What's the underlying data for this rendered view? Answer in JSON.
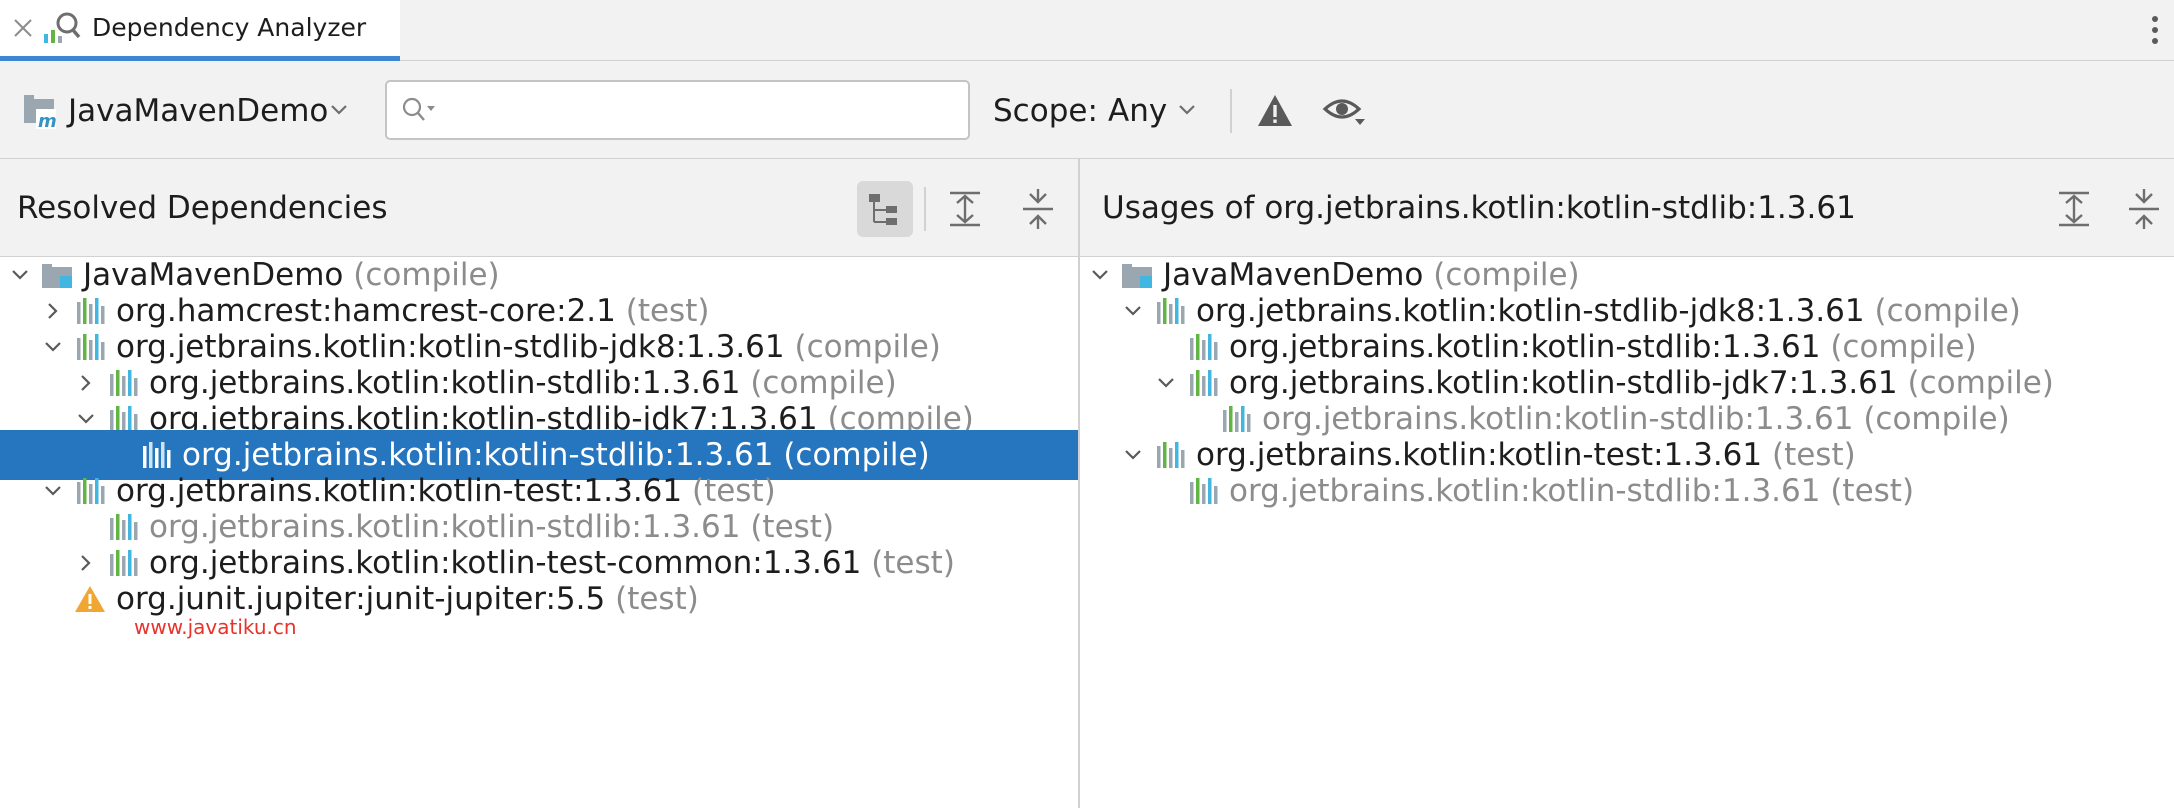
{
  "tab": {
    "title": "Dependency Analyzer"
  },
  "toolbar": {
    "project_name": "JavaMavenDemo",
    "search_value": "",
    "search_placeholder": "",
    "scope_label": "Scope:",
    "scope_value": "Any"
  },
  "left_panel": {
    "title": "Resolved Dependencies",
    "rows": [
      {
        "name": "JavaMavenDemo",
        "scope": "(compile)",
        "icon": "maven-module-icon",
        "depth": 0,
        "expander": "expanded",
        "selected": false,
        "dimmed": false
      },
      {
        "name": "org.hamcrest:hamcrest-core:2.1",
        "scope": "(test)",
        "icon": "library-icon",
        "depth": 1,
        "expander": "collapsed",
        "selected": false,
        "dimmed": false
      },
      {
        "name": "org.jetbrains.kotlin:kotlin-stdlib-jdk8:1.3.61",
        "scope": "(compile)",
        "icon": "library-icon",
        "depth": 1,
        "expander": "expanded",
        "selected": false,
        "dimmed": false
      },
      {
        "name": "org.jetbrains.kotlin:kotlin-stdlib:1.3.61",
        "scope": "(compile)",
        "icon": "library-icon",
        "depth": 2,
        "expander": "collapsed",
        "selected": false,
        "dimmed": false
      },
      {
        "name": "org.jetbrains.kotlin:kotlin-stdlib-jdk7:1.3.61",
        "scope": "(compile)",
        "icon": "library-icon",
        "depth": 2,
        "expander": "expanded",
        "selected": false,
        "dimmed": false
      },
      {
        "name": "org.jetbrains.kotlin:kotlin-stdlib:1.3.61",
        "scope": "(compile)",
        "icon": "library-icon",
        "depth": 3,
        "expander": "none",
        "selected": true,
        "dimmed": false
      },
      {
        "name": "org.jetbrains.kotlin:kotlin-test:1.3.61",
        "scope": "(test)",
        "icon": "library-icon",
        "depth": 1,
        "expander": "expanded",
        "selected": false,
        "dimmed": false
      },
      {
        "name": "org.jetbrains.kotlin:kotlin-stdlib:1.3.61",
        "scope": "(test)",
        "icon": "library-icon",
        "depth": 2,
        "expander": "none",
        "selected": false,
        "dimmed": true
      },
      {
        "name": "org.jetbrains.kotlin:kotlin-test-common:1.3.61",
        "scope": "(test)",
        "icon": "library-icon",
        "depth": 2,
        "expander": "collapsed",
        "selected": false,
        "dimmed": false
      },
      {
        "name": "org.junit.jupiter:junit-jupiter:5.5",
        "scope": "(test)",
        "icon": "warning-icon",
        "depth": 1,
        "expander": "none",
        "selected": false,
        "dimmed": false
      }
    ]
  },
  "right_panel": {
    "title": "Usages of org.jetbrains.kotlin:kotlin-stdlib:1.3.61",
    "rows": [
      {
        "name": "JavaMavenDemo",
        "scope": "(compile)",
        "icon": "maven-module-icon",
        "depth": 0,
        "expander": "expanded",
        "selected": false,
        "dimmed": false
      },
      {
        "name": "org.jetbrains.kotlin:kotlin-stdlib-jdk8:1.3.61",
        "scope": "(compile)",
        "icon": "library-icon",
        "depth": 1,
        "expander": "expanded",
        "selected": false,
        "dimmed": false
      },
      {
        "name": "org.jetbrains.kotlin:kotlin-stdlib:1.3.61",
        "scope": "(compile)",
        "icon": "library-icon",
        "depth": 2,
        "expander": "none",
        "selected": false,
        "dimmed": false
      },
      {
        "name": "org.jetbrains.kotlin:kotlin-stdlib-jdk7:1.3.61",
        "scope": "(compile)",
        "icon": "library-icon",
        "depth": 2,
        "expander": "expanded",
        "selected": false,
        "dimmed": false
      },
      {
        "name": "org.jetbrains.kotlin:kotlin-stdlib:1.3.61",
        "scope": "(compile)",
        "icon": "library-icon",
        "depth": 3,
        "expander": "none",
        "selected": false,
        "dimmed": true
      },
      {
        "name": "org.jetbrains.kotlin:kotlin-test:1.3.61",
        "scope": "(test)",
        "icon": "library-icon",
        "depth": 1,
        "expander": "expanded",
        "selected": false,
        "dimmed": false
      },
      {
        "name": "org.jetbrains.kotlin:kotlin-stdlib:1.3.61",
        "scope": "(test)",
        "icon": "library-icon",
        "depth": 2,
        "expander": "none",
        "selected": false,
        "dimmed": true
      }
    ]
  },
  "watermark": "www.javatiku.cn",
  "colors": {
    "accent": "#3d86d3",
    "selection": "#2675bf",
    "scope_text": "#8c8c8c",
    "warning": "#f0a732"
  }
}
